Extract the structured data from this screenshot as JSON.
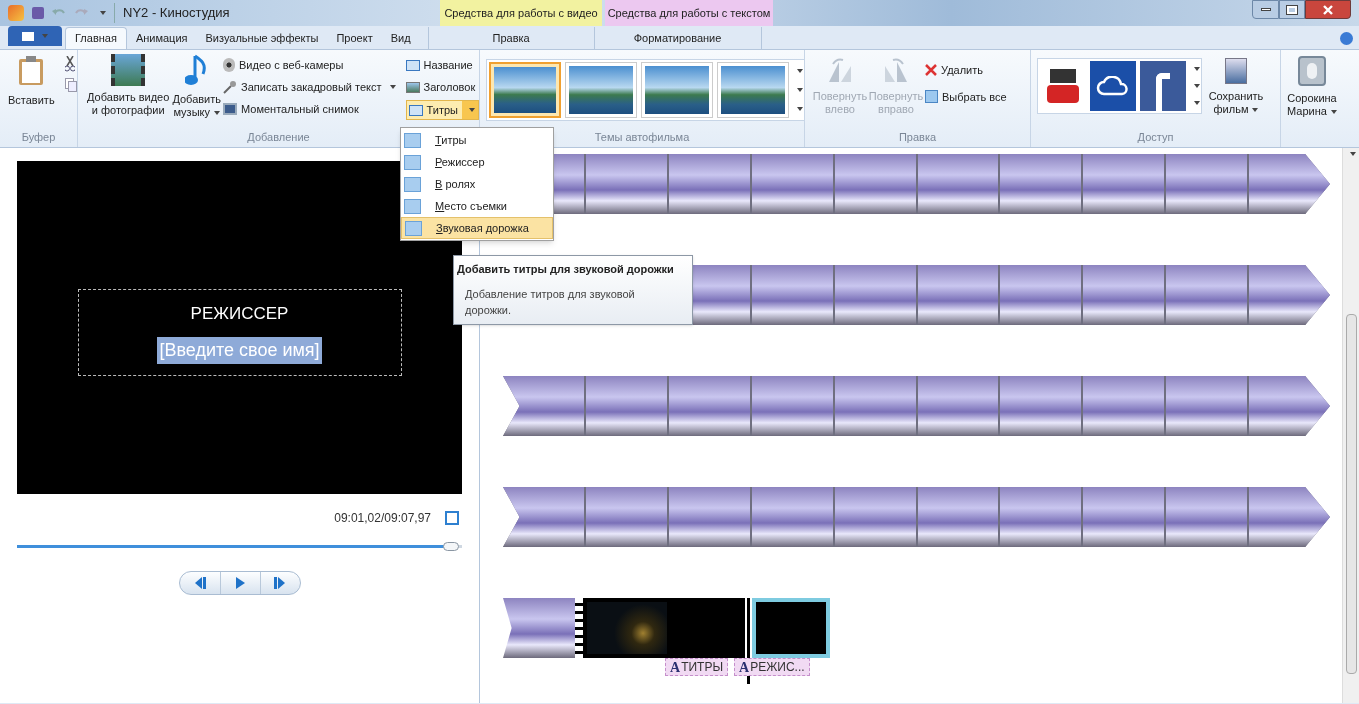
{
  "window": {
    "title": "NY2 - Киностудия"
  },
  "context_groups": [
    {
      "label": "Средства для работы с видео",
      "color": "#f2f2a0",
      "tab": {
        "label": "Правка",
        "selected": false
      }
    },
    {
      "label": "Средства для работы с текстом",
      "color": "#ecc8f0",
      "tab": {
        "label": "Форматирование",
        "selected": false
      }
    }
  ],
  "tabs": [
    {
      "label": "Главная",
      "selected": true
    },
    {
      "label": "Анимация",
      "selected": false
    },
    {
      "label": "Визуальные эффекты",
      "selected": false
    },
    {
      "label": "Проект",
      "selected": false
    },
    {
      "label": "Вид",
      "selected": false
    }
  ],
  "ribbon": {
    "clipboard": {
      "label": "Буфер",
      "paste": "Вставить"
    },
    "add": {
      "label": "Добавление",
      "add_video": "Добавить видео и фотографии",
      "add_music": "Добавить музыку",
      "webcam": "Видео с веб-камеры",
      "narration": "Записать закадровый текст",
      "snapshot": "Моментальный снимок",
      "title": "Название",
      "caption": "Заголовок",
      "credits": "Титры",
      "credits_open": true
    },
    "themes": {
      "label": "Темы автофильма",
      "items": [
        {
          "selected": true
        },
        {
          "selected": false
        },
        {
          "selected": false
        },
        {
          "selected": false
        }
      ]
    },
    "editing": {
      "label": "Правка",
      "rotate": [
        {
          "label": "Повернуть влево",
          "disabled": true
        },
        {
          "label": "Повернуть вправо",
          "disabled": true
        }
      ],
      "delete": "Удалить",
      "select_all": "Выбрать все"
    },
    "share": {
      "label": "Доступ",
      "save_movie": "Сохранить фильм"
    },
    "account": "Сорокина Марина"
  },
  "credits_menu": [
    {
      "label": "Титры",
      "selected": false
    },
    {
      "label": "Режиссер",
      "selected": false
    },
    {
      "label": "В ролях",
      "selected": false
    },
    {
      "label": "Место съемки",
      "selected": false
    },
    {
      "label": "Звуковая дорожка",
      "selected": true
    }
  ],
  "tooltip": {
    "title": "Добавить титры для звуковой дорожки",
    "body": "Добавление титров для звуковой дорожки."
  },
  "preview": {
    "caption_title": "РЕЖИССЕР",
    "caption_field": "[Введите свое имя]",
    "time": "09:01,02/09:07,97",
    "seek": {
      "level": 0.975
    }
  },
  "storyboard": {
    "rows": [
      {
        "kind": "video"
      },
      {
        "kind": "video"
      },
      {
        "kind": "video"
      },
      {
        "kind": "video"
      },
      {
        "kind": "titles"
      }
    ],
    "title_clips": [
      {
        "selected": false
      },
      {
        "selected": true
      }
    ],
    "captions": [
      {
        "letter": "A",
        "label": "ТИТРЫ"
      },
      {
        "letter": "A",
        "label": "РЕЖИС..."
      }
    ]
  }
}
